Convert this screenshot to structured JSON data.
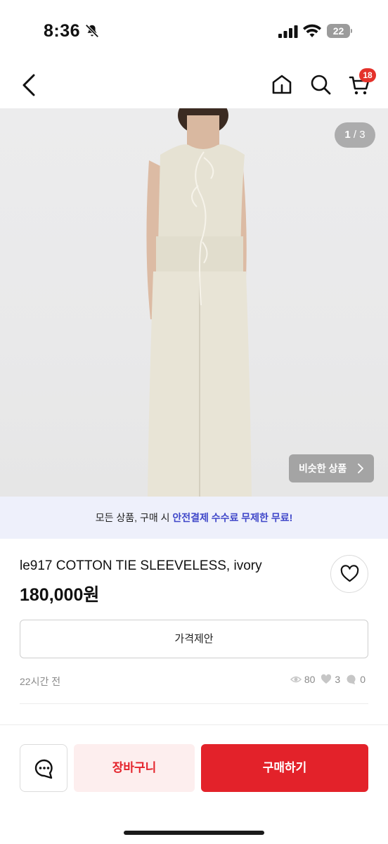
{
  "status_bar": {
    "time": "8:36",
    "battery": "22"
  },
  "top_nav": {
    "cart_count": "18"
  },
  "gallery": {
    "current": "1",
    "separator": " / ",
    "total": "3",
    "similar_label": "비슷한 상품"
  },
  "promo": {
    "prefix": "모든 상품, 구매 시 ",
    "highlight": "안전결제 수수료 무제한 무료!"
  },
  "product": {
    "title": "le917 COTTON TIE SLEEVELESS, ivory",
    "price": "180,000원"
  },
  "offer_label": "가격제안",
  "meta": {
    "posted": "22시간 전",
    "views": "80",
    "likes": "3",
    "chats": "0"
  },
  "actions": {
    "cart_label": "장바구니",
    "buy_label": "구매하기"
  },
  "colors": {
    "accent_red": "#e3222a",
    "promo_blue": "#3f47c9",
    "promo_bg": "#eef0fb"
  },
  "icons": [
    "bell-slash-icon",
    "signal-icon",
    "wifi-icon",
    "back-icon",
    "home-icon",
    "search-icon",
    "cart-icon",
    "chevron-right-icon",
    "heart-icon",
    "eye-icon",
    "chat-bubble-icon",
    "chat-icon"
  ]
}
